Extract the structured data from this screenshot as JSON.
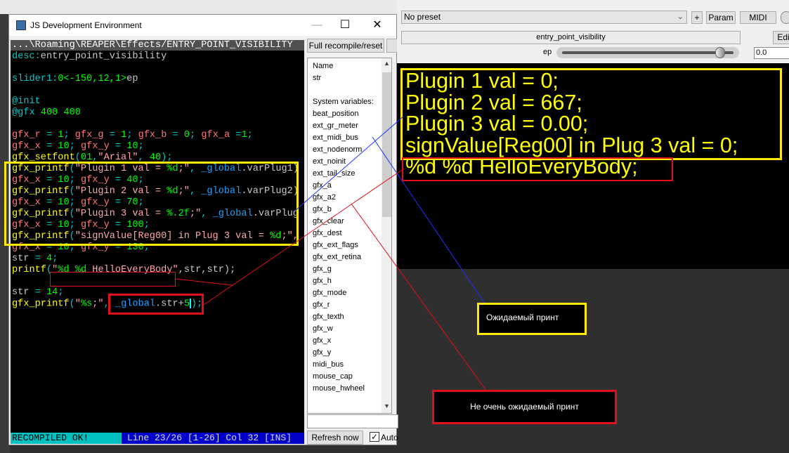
{
  "editor": {
    "title": "JS Development Environment",
    "window_buttons": {
      "minimize": "—",
      "maximize": "☐",
      "close": "✕"
    },
    "path": "...\\Roaming\\REAPER\\Effects/ENTRY_POINT_VISIBILITY",
    "code_lines": [
      [
        [
          "desc:",
          "kw"
        ],
        [
          "entry_point_visibility",
          "def"
        ]
      ],
      [],
      [
        [
          "slider1:",
          "kw"
        ],
        [
          "0<-150,12,1>",
          "num"
        ],
        [
          "ep",
          "def"
        ]
      ],
      [],
      [
        [
          "@init",
          "kw"
        ]
      ],
      [
        [
          "@gfx ",
          "kw"
        ],
        [
          "400 400",
          "num"
        ]
      ],
      [],
      [
        [
          "gfx_r",
          "var"
        ],
        [
          " = ",
          "op"
        ],
        [
          "1",
          "num"
        ],
        [
          "; ",
          "op"
        ],
        [
          "gfx_g",
          "var"
        ],
        [
          " = ",
          "op"
        ],
        [
          "1",
          "num"
        ],
        [
          "; ",
          "op"
        ],
        [
          "gfx_b",
          "var"
        ],
        [
          " = ",
          "op"
        ],
        [
          "0",
          "num"
        ],
        [
          "; ",
          "op"
        ],
        [
          "gfx_a",
          "var"
        ],
        [
          " =",
          "op"
        ],
        [
          "1",
          "num"
        ],
        [
          ";",
          "op"
        ]
      ],
      [
        [
          "gfx_x",
          "var"
        ],
        [
          " = ",
          "op"
        ],
        [
          "10",
          "num"
        ],
        [
          "; ",
          "op"
        ],
        [
          "gfx_y",
          "var"
        ],
        [
          " = ",
          "op"
        ],
        [
          "10",
          "num"
        ],
        [
          ";",
          "op"
        ]
      ],
      [
        [
          "gfx_setfont",
          "fn"
        ],
        [
          "(",
          "op"
        ],
        [
          "01",
          "num"
        ],
        [
          ",",
          "op"
        ],
        [
          "\"Arial\"",
          "str"
        ],
        [
          ", ",
          "op"
        ],
        [
          "40",
          "num"
        ],
        [
          ");",
          "op"
        ]
      ],
      [
        [
          "gfx_printf",
          "fn"
        ],
        [
          "(",
          "op"
        ],
        [
          "\"Plugin 1 val = ",
          "str"
        ],
        [
          "%d",
          "num"
        ],
        [
          ";\"",
          "str"
        ],
        [
          ", ",
          "op"
        ],
        [
          "_global",
          "glob"
        ],
        [
          ".varPlug1)",
          "def"
        ]
      ],
      [
        [
          "gfx_x",
          "var"
        ],
        [
          " = ",
          "op"
        ],
        [
          "10",
          "num"
        ],
        [
          "; ",
          "op"
        ],
        [
          "gfx_y",
          "var"
        ],
        [
          " = ",
          "op"
        ],
        [
          "40",
          "num"
        ],
        [
          ";",
          "op"
        ]
      ],
      [
        [
          "gfx_printf",
          "fn"
        ],
        [
          "(",
          "op"
        ],
        [
          "\"Plugin 2 val = ",
          "str"
        ],
        [
          "%d",
          "num"
        ],
        [
          ";\"",
          "str"
        ],
        [
          ", ",
          "op"
        ],
        [
          "_global",
          "glob"
        ],
        [
          ".varPlug2)",
          "def"
        ]
      ],
      [
        [
          "gfx_x",
          "var"
        ],
        [
          " = ",
          "op"
        ],
        [
          "10",
          "num"
        ],
        [
          "; ",
          "op"
        ],
        [
          "gfx_y",
          "var"
        ],
        [
          " = ",
          "op"
        ],
        [
          "70",
          "num"
        ],
        [
          ";",
          "op"
        ]
      ],
      [
        [
          "gfx_printf",
          "fn"
        ],
        [
          "(",
          "op"
        ],
        [
          "\"Plugin 3 val = ",
          "str"
        ],
        [
          "%.2f",
          "num"
        ],
        [
          ";\"",
          "str"
        ],
        [
          ", ",
          "op"
        ],
        [
          "_global",
          "glob"
        ],
        [
          ".varPlug",
          "def"
        ]
      ],
      [
        [
          "gfx_x",
          "var"
        ],
        [
          " = ",
          "op"
        ],
        [
          "10",
          "num"
        ],
        [
          "; ",
          "op"
        ],
        [
          "gfx_y",
          "var"
        ],
        [
          " = ",
          "op"
        ],
        [
          "100",
          "num"
        ],
        [
          ";",
          "op"
        ]
      ],
      [
        [
          "gfx_printf",
          "fn"
        ],
        [
          "(",
          "op"
        ],
        [
          "\"signValue[Reg00] in Plug 3 val = ",
          "str"
        ],
        [
          "%d",
          "num"
        ],
        [
          ";\",",
          "str"
        ]
      ],
      [
        [
          "gfx_x",
          "var"
        ],
        [
          " = ",
          "op"
        ],
        [
          "10",
          "num"
        ],
        [
          "; ",
          "op"
        ],
        [
          "gfx_y",
          "var"
        ],
        [
          " = ",
          "op"
        ],
        [
          "130",
          "num"
        ],
        [
          ";",
          "op"
        ]
      ],
      [
        [
          "str",
          "def"
        ],
        [
          " = ",
          "op"
        ],
        [
          "4",
          "num"
        ],
        [
          ";",
          "op"
        ]
      ],
      [
        [
          "printf",
          "fn"
        ],
        [
          "(",
          "op"
        ],
        [
          "\"",
          "str"
        ],
        [
          "%d",
          "num"
        ],
        [
          " ",
          "str"
        ],
        [
          "%d",
          "num"
        ],
        [
          " HelloEveryBody\"",
          "str"
        ],
        [
          ",str,str);",
          "def"
        ]
      ],
      [],
      [
        [
          "str",
          "def"
        ],
        [
          " = ",
          "op"
        ],
        [
          "14",
          "num"
        ],
        [
          ";",
          "op"
        ]
      ],
      [
        [
          "gfx_printf",
          "fn"
        ],
        [
          "(",
          "op"
        ],
        [
          "\"",
          "str"
        ],
        [
          "%s",
          "num"
        ],
        [
          ";\"",
          "str"
        ],
        [
          ", ",
          "op"
        ],
        [
          "_global",
          "glob"
        ],
        [
          ".str+",
          "def"
        ],
        [
          "5",
          "num"
        ],
        [
          "|CURSOR|",
          "cur"
        ],
        [
          ");",
          "op"
        ]
      ]
    ],
    "status_ok": "RECOMPILED OK!",
    "status_position": "Line 23/26 [1-26] Col 32 [INS]",
    "full_recompile_label": "Full recompile/reset",
    "variables": [
      "Name",
      "str",
      "",
      "System variables:",
      "beat_position",
      "ext_gr_meter",
      "ext_midi_bus",
      "ext_nodenorm",
      "ext_noinit",
      "ext_tail_size",
      "gfx_a",
      "gfx_a2",
      "gfx_b",
      "gfx_clear",
      "gfx_dest",
      "gfx_ext_flags",
      "gfx_ext_retina",
      "gfx_g",
      "gfx_h",
      "gfx_mode",
      "gfx_r",
      "gfx_texth",
      "gfx_w",
      "gfx_x",
      "gfx_y",
      "midi_bus",
      "mouse_cap",
      "mouse_hwheel"
    ],
    "refresh_label": "Refresh now",
    "auto_label": "Auto",
    "auto_checked": true
  },
  "plugin": {
    "preset": "No preset",
    "plus_label": "+",
    "param_label": "Param",
    "midi_label": "MIDI",
    "fx_name": "entry_point_visibility",
    "edit_label": "Edi",
    "slider_label": "ep",
    "slider_value": "0.0",
    "gfx_output": [
      "Plugin 1 val = 0;",
      "Plugin 2 val = 667;",
      "Plugin 3 val = 0.00;",
      "signValue[Reg00] in Plug 3 val = 0;",
      "%d %d HelloEveryBody;"
    ]
  },
  "annotations": {
    "expected": "Ожидаемый принт",
    "unexpected": "Не очень ожидаемый принт",
    "colors": {
      "expected": "#ffea00",
      "unexpected": "#e0101a",
      "connector_blue": "#2030ff"
    }
  }
}
